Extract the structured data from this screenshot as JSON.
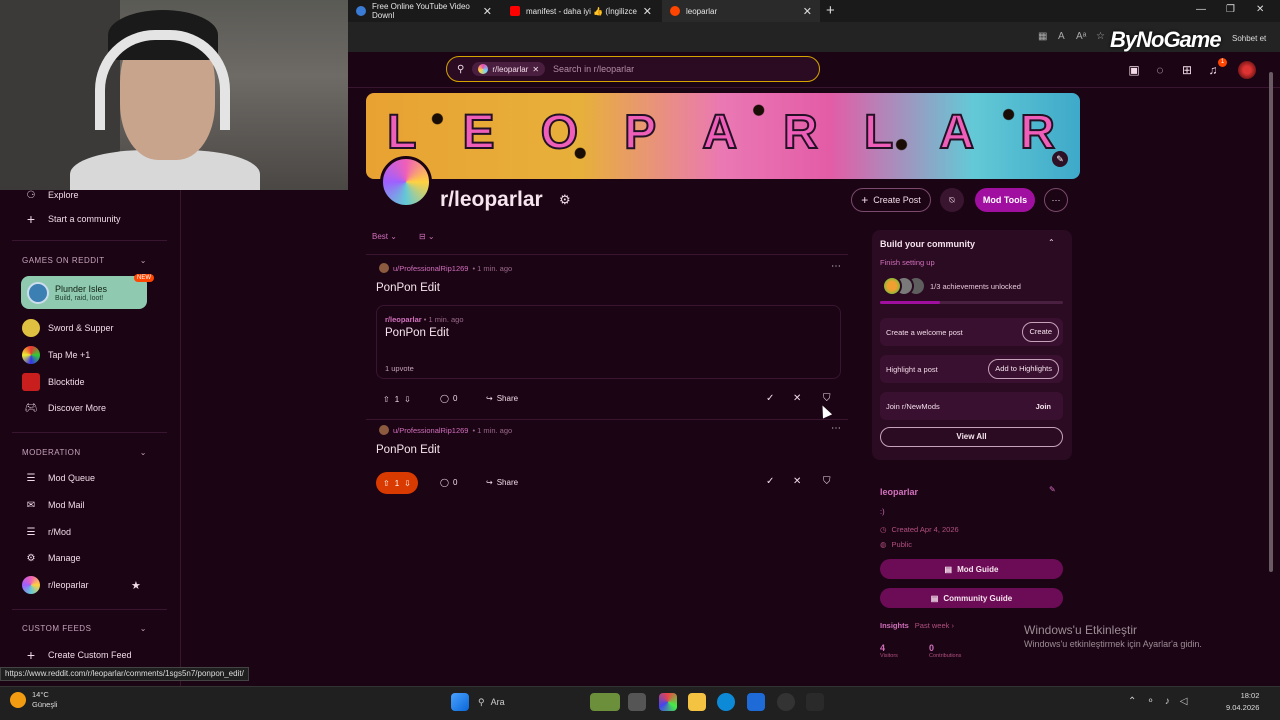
{
  "browser": {
    "tabs": [
      {
        "label": "Free Online YouTube Video Downl",
        "color": "#3a7bd5"
      },
      {
        "label": "manifest - daha iyi 👍 (İngilizce ve",
        "color": "#ff0000"
      },
      {
        "label": "leoparlar",
        "color": "#ff4500"
      }
    ],
    "brand": "ByNoGame",
    "chat_label": "Sohbet et"
  },
  "header": {
    "search_chip": "r/leoparlar",
    "search_placeholder": "Search in r/leoparlar",
    "notification_count": "1"
  },
  "sidebar": {
    "explore": "Explore",
    "start_community": "Start a community",
    "games_heading": "GAMES ON REDDIT",
    "plunder": {
      "title": "Plunder Isles",
      "subtitle": "Build, raid, loot!",
      "badge": "NEW"
    },
    "games": [
      "Sword & Supper",
      "Tap Me +1",
      "Blocktide",
      "Discover More"
    ],
    "moderation_heading": "MODERATION",
    "moderation": [
      "Mod Queue",
      "Mod Mail",
      "r/Mod",
      "Manage",
      "r/leoparlar"
    ],
    "custom_feeds_heading": "CUSTOM FEEDS",
    "create_custom_feed": "Create Custom Feed"
  },
  "community": {
    "banner_letters": [
      "L",
      "E",
      "O",
      "P",
      "A",
      "R",
      "L",
      "A",
      "R"
    ],
    "name": "r/leoparlar",
    "create_post": "Create Post",
    "mod_tools": "Mod Tools"
  },
  "feed": {
    "sort": "Best",
    "posts": [
      {
        "author": "u/ProfessionalRip1269",
        "time": "• 1 min. ago",
        "title": "PonPon Edit",
        "embed": {
          "sub": "r/leoparlar",
          "time": "• 1 min. ago",
          "title": "PonPon Edit",
          "votes": "1 upvote"
        },
        "score": "1",
        "comments": "0",
        "share": "Share"
      },
      {
        "author": "u/ProfessionalRip1269",
        "time": "• 1 min. ago",
        "title": "PonPon Edit",
        "score": "1",
        "comments": "0",
        "share": "Share"
      }
    ]
  },
  "build": {
    "title": "Build your community",
    "subtitle": "Finish setting up",
    "achievements": "1/3 achievements unlocked",
    "progress": 0.33,
    "tasks": [
      {
        "label": "Create a welcome post",
        "action": "Create"
      },
      {
        "label": "Highlight a post",
        "action": "Add to Highlights"
      },
      {
        "label": "Join r/NewMods",
        "action": "Join"
      }
    ],
    "view_all": "View All"
  },
  "about": {
    "name": "leoparlar",
    "description": ":)",
    "created": "Created Apr 4, 2026",
    "visibility": "Public",
    "mod_guide": "Mod Guide",
    "community_guide": "Community Guide",
    "insights_label": "Insights",
    "insights_period": "Past week ›",
    "visitors_value": "4",
    "visitors_label": "Visitors",
    "contributions_value": "0",
    "contributions_label": "Contributions"
  },
  "windows_activation": {
    "title": "Windows'u Etkinleştir",
    "subtitle": "Windows'u etkinleştirmek için Ayarlar'a gidin."
  },
  "status_url": "https://www.reddit.com/r/leoparlar/comments/1sgs5n7/ponpon_edit/",
  "taskbar": {
    "weather_temp": "14°C",
    "weather_desc": "Güneşli",
    "search": "Ara",
    "time": "18:02",
    "date": "9.04.2026"
  }
}
